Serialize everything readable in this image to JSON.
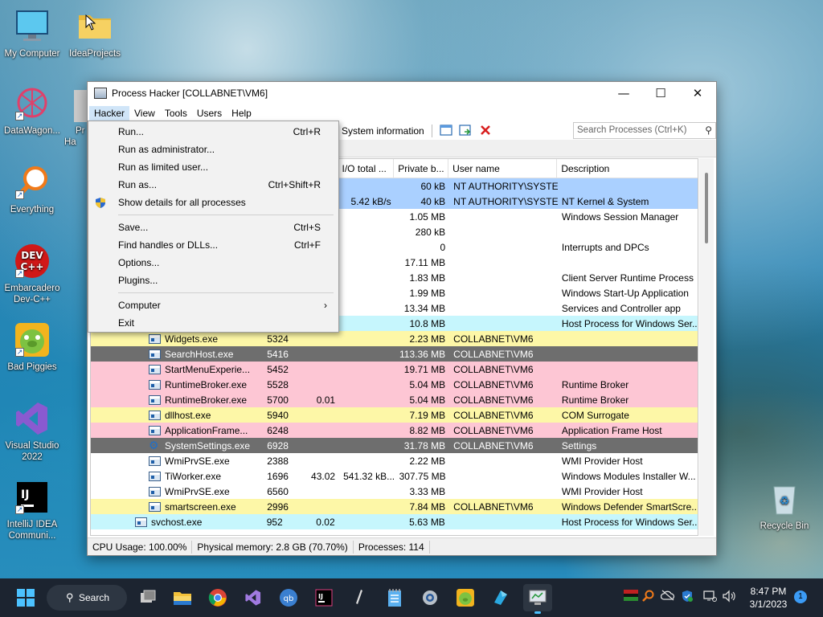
{
  "desktop": {
    "icons": [
      {
        "label": "My Computer"
      },
      {
        "label": "IdeaProjects"
      },
      {
        "label": "DataWagon..."
      },
      {
        "label": "Everything"
      },
      {
        "label": "Embarcadero Dev-C++"
      },
      {
        "label": "Bad Piggies"
      },
      {
        "label": "Visual Studio 2022"
      },
      {
        "label": "IntelliJ IDEA Communi..."
      },
      {
        "label": "Recycle Bin"
      }
    ],
    "partial_label": "Pr Ha"
  },
  "window": {
    "title": "Process Hacker [COLLABNET\\VM6]",
    "controls": {
      "minimize": "—",
      "maximize": "☐",
      "close": "✕"
    }
  },
  "menubar": [
    "Hacker",
    "View",
    "Tools",
    "Users",
    "Help"
  ],
  "toolbar": {
    "system_information": "System information",
    "search_placeholder": "Search Processes (Ctrl+K)"
  },
  "hacker_menu": {
    "run": {
      "label": "Run...",
      "shortcut": "Ctrl+R"
    },
    "run_admin": {
      "label": "Run as administrator..."
    },
    "run_limited": {
      "label": "Run as limited user..."
    },
    "run_as": {
      "label": "Run as...",
      "shortcut": "Ctrl+Shift+R"
    },
    "show_details": {
      "label": "Show details for all processes"
    },
    "save": {
      "label": "Save...",
      "shortcut": "Ctrl+S"
    },
    "find_handles": {
      "label": "Find handles or DLLs...",
      "shortcut": "Ctrl+F"
    },
    "options": {
      "label": "Options..."
    },
    "plugins": {
      "label": "Plugins..."
    },
    "computer": {
      "label": "Computer"
    },
    "exit": {
      "label": "Exit"
    }
  },
  "table": {
    "columns": {
      "io_total": "I/O total ...",
      "private_bytes": "Private b...",
      "user_name": "User name",
      "description": "Description"
    },
    "rows": [
      {
        "name": "",
        "pid": "",
        "cpu": "",
        "io": "",
        "priv": "60 kB",
        "user": "NT AUTHORITY\\SYSTEM",
        "desc": "",
        "style": "sys",
        "icon": "none"
      },
      {
        "name": "",
        "pid": "",
        "cpu": "",
        "io": "5.42 kB/s",
        "priv": "40 kB",
        "user": "NT AUTHORITY\\SYSTEM",
        "desc": "NT Kernel & System",
        "style": "sys",
        "icon": "none"
      },
      {
        "name": "",
        "pid": "",
        "cpu": "",
        "io": "",
        "priv": "1.05 MB",
        "user": "",
        "desc": "Windows Session Manager",
        "style": "white",
        "icon": "none"
      },
      {
        "name": "",
        "pid": "",
        "cpu": "",
        "io": "",
        "priv": "280 kB",
        "user": "",
        "desc": "",
        "style": "white",
        "icon": "none"
      },
      {
        "name": "",
        "pid": "",
        "cpu": "",
        "io": "",
        "priv": "0",
        "user": "",
        "desc": "Interrupts and DPCs",
        "style": "white",
        "icon": "none"
      },
      {
        "name": "",
        "pid": "",
        "cpu": "",
        "io": "",
        "priv": "17.11 MB",
        "user": "",
        "desc": "",
        "style": "white",
        "icon": "none"
      },
      {
        "name": "",
        "pid": "",
        "cpu": "",
        "io": "",
        "priv": "1.83 MB",
        "user": "",
        "desc": "Client Server Runtime Process",
        "style": "white",
        "icon": "none"
      },
      {
        "name": "",
        "pid": "",
        "cpu": "",
        "io": "",
        "priv": "1.99 MB",
        "user": "",
        "desc": "Windows Start-Up Application",
        "style": "white",
        "icon": "none"
      },
      {
        "name": "",
        "pid": "",
        "cpu": "",
        "io": "",
        "priv": "13.34 MB",
        "user": "",
        "desc": "Services and Controller app",
        "style": "white",
        "icon": "none"
      },
      {
        "name": "",
        "pid": "",
        "cpu": "",
        "io": "",
        "priv": "10.8 MB",
        "user": "",
        "desc": "Host Process for Windows Ser...",
        "style": "svc",
        "icon": "none"
      },
      {
        "name": "Widgets.exe",
        "pid": "5324",
        "cpu": "",
        "io": "",
        "priv": "2.23 MB",
        "user": "COLLABNET\\VM6",
        "desc": "",
        "style": "own",
        "icon": "win"
      },
      {
        "name": "SearchHost.exe",
        "pid": "5416",
        "cpu": "",
        "io": "",
        "priv": "113.36 MB",
        "user": "COLLABNET\\VM6",
        "desc": "",
        "style": "susp",
        "icon": "win"
      },
      {
        "name": "StartMenuExperie...",
        "pid": "5452",
        "cpu": "",
        "io": "",
        "priv": "19.71 MB",
        "user": "COLLABNET\\VM6",
        "desc": "",
        "style": "pink",
        "icon": "win"
      },
      {
        "name": "RuntimeBroker.exe",
        "pid": "5528",
        "cpu": "",
        "io": "",
        "priv": "5.04 MB",
        "user": "COLLABNET\\VM6",
        "desc": "Runtime Broker",
        "style": "pink",
        "icon": "win"
      },
      {
        "name": "RuntimeBroker.exe",
        "pid": "5700",
        "cpu": "0.01",
        "io": "",
        "priv": "5.04 MB",
        "user": "COLLABNET\\VM6",
        "desc": "Runtime Broker",
        "style": "pink",
        "icon": "win"
      },
      {
        "name": "dllhost.exe",
        "pid": "5940",
        "cpu": "",
        "io": "",
        "priv": "7.19 MB",
        "user": "COLLABNET\\VM6",
        "desc": "COM Surrogate",
        "style": "own",
        "icon": "win"
      },
      {
        "name": "ApplicationFrame...",
        "pid": "6248",
        "cpu": "",
        "io": "",
        "priv": "8.82 MB",
        "user": "COLLABNET\\VM6",
        "desc": "Application Frame Host",
        "style": "pink",
        "icon": "win"
      },
      {
        "name": "SystemSettings.exe",
        "pid": "6928",
        "cpu": "",
        "io": "",
        "priv": "31.78 MB",
        "user": "COLLABNET\\VM6",
        "desc": "Settings",
        "style": "susp",
        "icon": "gear"
      },
      {
        "name": "WmiPrvSE.exe",
        "pid": "2388",
        "cpu": "",
        "io": "",
        "priv": "2.22 MB",
        "user": "",
        "desc": "WMI Provider Host",
        "style": "white",
        "icon": "win"
      },
      {
        "name": "TiWorker.exe",
        "pid": "1696",
        "cpu": "43.02",
        "io": "541.32 kB...",
        "priv": "307.75 MB",
        "user": "",
        "desc": "Windows Modules Installer W...",
        "style": "white",
        "icon": "win"
      },
      {
        "name": "WmiPrvSE.exe",
        "pid": "6560",
        "cpu": "",
        "io": "",
        "priv": "3.33 MB",
        "user": "",
        "desc": "WMI Provider Host",
        "style": "white",
        "icon": "win"
      },
      {
        "name": "smartscreen.exe",
        "pid": "2996",
        "cpu": "",
        "io": "",
        "priv": "7.84 MB",
        "user": "COLLABNET\\VM6",
        "desc": "Windows Defender SmartScre...",
        "style": "own",
        "icon": "win"
      },
      {
        "name": "svchost.exe",
        "pid": "952",
        "cpu": "0.02",
        "io": "",
        "priv": "5.63 MB",
        "user": "",
        "desc": "Host Process for Windows Ser...",
        "style": "svc",
        "icon": "win",
        "indent": 1
      }
    ]
  },
  "statusbar": {
    "cpu": "CPU Usage: 100.00%",
    "memory": "Physical memory: 2.8 GB (70.70%)",
    "processes": "Processes: 114"
  },
  "taskbar": {
    "search": "Search",
    "time": "8:47 PM",
    "date": "3/1/2023",
    "notifications": "1"
  },
  "colors": {
    "services": "#c6f6fd",
    "own_process": "#fdf7a7",
    "system": "#aad0ff",
    "suspended": "#6e6e6e",
    "immersive": "#fdc6d4"
  }
}
